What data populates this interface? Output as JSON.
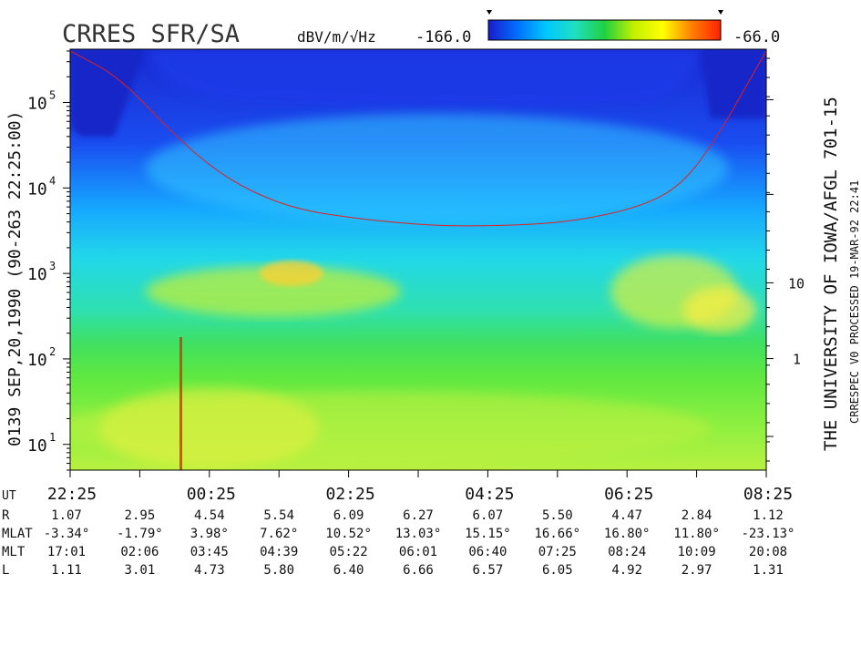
{
  "title": "CRRES SFR/SA",
  "units_label": "dBV/m/√Hz",
  "colorbar": {
    "min_label": "-166.0",
    "max_label": "-66.0",
    "min": -166.0,
    "max": -66.0,
    "colors": [
      "#1a1acc",
      "#0070ff",
      "#00c8ff",
      "#20e0c0",
      "#20d040",
      "#c0f000",
      "#ffff00",
      "#ff8000",
      "#ff2000"
    ]
  },
  "left_label": "0139   SEP,20,1990  (90-263 22:25:00)",
  "right_label_main": "THE UNIVERSITY OF IOWA/AFGL 701-15",
  "right_label_small": "CRRESPEC V0    PROCESSED 19-MAR-92  22:41",
  "right_axis_ticks": [
    "10",
    "1"
  ],
  "chart_data": {
    "type": "heatmap",
    "title": "CRRES SFR/SA",
    "xlabel": "UT",
    "ylabel": "",
    "y_scale": "log",
    "ylim": [
      5,
      420000
    ],
    "y_ticks": [
      {
        "value": 10,
        "label": "10",
        "exp": "1"
      },
      {
        "value": 100,
        "label": "10",
        "exp": "2"
      },
      {
        "value": 1000,
        "label": "10",
        "exp": "3"
      },
      {
        "value": 10000,
        "label": "10",
        "exp": "4"
      },
      {
        "value": 100000,
        "label": "10",
        "exp": "5"
      }
    ],
    "x_range": [
      "22:25",
      "08:25"
    ],
    "x_tick_labels": [
      "22:25",
      "00:25",
      "02:25",
      "04:25",
      "06:25",
      "08:25"
    ],
    "ephemeris": {
      "row_labels": [
        "UT",
        "R",
        "MLAT",
        "MLT",
        "L"
      ],
      "R": [
        "1.07",
        "2.95",
        "4.54",
        "5.54",
        "6.09",
        "6.27",
        "6.07",
        "5.50",
        "4.47",
        "2.84",
        "1.12"
      ],
      "MLAT": [
        "-3.34°",
        "-1.79°",
        "3.98°",
        "7.62°",
        "10.52°",
        "13.03°",
        "15.15°",
        "16.66°",
        "16.80°",
        "11.80°",
        "-23.13°"
      ],
      "MLT": [
        "17:01",
        "02:06",
        "03:45",
        "04:39",
        "05:22",
        "06:01",
        "06:40",
        "07:25",
        "08:24",
        "10:09",
        "20:08"
      ],
      "L": [
        "1.11",
        "3.01",
        "4.73",
        "5.80",
        "6.40",
        "6.66",
        "6.57",
        "6.05",
        "4.92",
        "2.97",
        "1.31"
      ]
    },
    "overlay_line": {
      "color": "#e02020",
      "points": [
        [
          0.0,
          400000
        ],
        [
          0.07,
          200000
        ],
        [
          0.14,
          50000
        ],
        [
          0.2,
          18000
        ],
        [
          0.26,
          9000
        ],
        [
          0.33,
          5500
        ],
        [
          0.42,
          4300
        ],
        [
          0.52,
          3600
        ],
        [
          0.62,
          3600
        ],
        [
          0.72,
          4000
        ],
        [
          0.82,
          6000
        ],
        [
          0.88,
          11000
        ],
        [
          0.93,
          40000
        ],
        [
          0.97,
          150000
        ],
        [
          1.0,
          400000
        ]
      ]
    }
  }
}
